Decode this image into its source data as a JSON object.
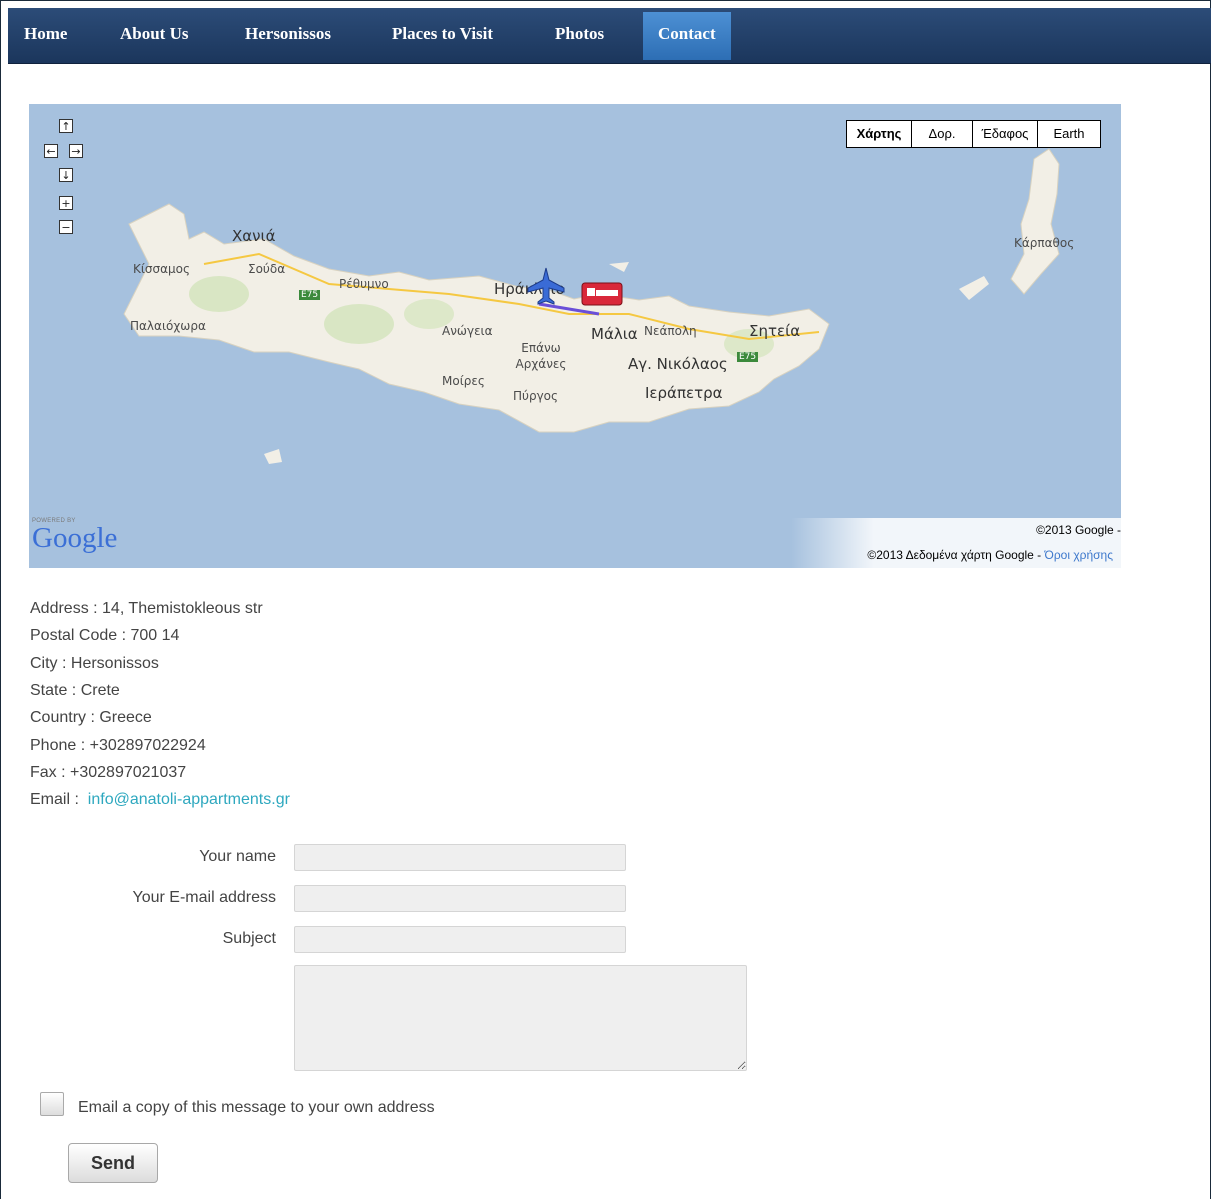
{
  "nav": {
    "items": [
      "Home",
      "About Us",
      "Hersonissos",
      "Places to Visit",
      "Photos",
      "Contact"
    ],
    "active": "Contact"
  },
  "map": {
    "pan_controls": [
      "↑",
      "←",
      "→",
      "↓",
      "+",
      "−"
    ],
    "map_types": [
      "Χάρτης",
      "Δορ.",
      "Έδαφος",
      "Earth"
    ],
    "selected_map_type": "Χάρτης",
    "place_labels": [
      "Χανιά",
      "Κίσσαμος",
      "Σούδα",
      "Ρέθυμνο",
      "Ηράκλειο",
      "Παλαιόχωρα",
      "Ανώγεια",
      "Επάνω Αρχάνες",
      "Μάλια",
      "Νεάπολη",
      "Σητεία",
      "Αγ. Νικόλαος",
      "Μοίρες",
      "Πύργος",
      "Ιεράπετρα",
      "Κάρπαθος"
    ],
    "road_shields": [
      "E75",
      "E75"
    ],
    "powered_by": "POWERED BY",
    "google_logo": "Google",
    "copyright_1": "©2013 Google -",
    "copyright_2": "©2013 Δεδομένα χάρτη Google -",
    "terms_link": "Όροι χρήσης",
    "colors": {
      "water": "#a6c1de",
      "land": "#f2efe6",
      "route": "#6a4fd8",
      "airport": "#3a6bd6",
      "hotel": "#d9283a"
    },
    "markers": [
      "airport-icon",
      "hotel-bed-icon"
    ]
  },
  "contact": {
    "address": "Address : 14, Themistokleous str",
    "postal": "Postal Code : 700 14",
    "city": "City : Hersonissos",
    "state": "State : Crete",
    "country": "Country : Greece",
    "phone": "Phone : +302897022924",
    "fax": "Fax : +302897021037",
    "email_label": "Email :",
    "email": "info@anatoli-appartments.gr"
  },
  "form": {
    "name_label": "Your name",
    "email_label": "Your E-mail address",
    "subject_label": "Subject",
    "name_value": "",
    "email_value": "",
    "subject_value": "",
    "message_value": "",
    "copy_checked": false,
    "copy_label": "Email a copy of this message to your own address",
    "send_label": "Send"
  }
}
